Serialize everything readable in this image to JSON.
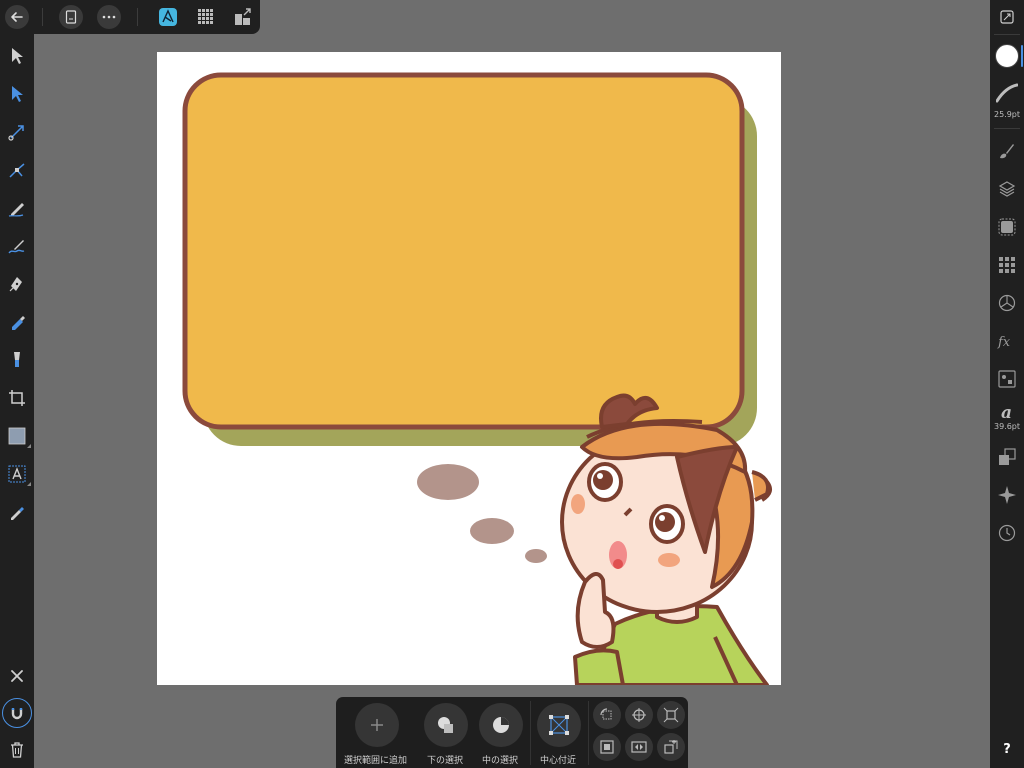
{
  "top_toolbar": {
    "items": [
      "back-icon",
      "document-icon",
      "more-icon",
      "designer-persona-icon",
      "pixel-persona-icon",
      "export-persona-icon"
    ]
  },
  "left_tools": [
    "move-tool-icon",
    "node-tool-icon",
    "point-transform-tool-icon",
    "corner-tool-icon",
    "pencil-tool-icon",
    "vector-brush-tool-icon",
    "pen-tool-icon",
    "fill-tool-icon",
    "transparency-tool-icon",
    "crop-tool-icon",
    "rectangle-shape-tool-icon",
    "artistic-text-tool-icon",
    "color-picker-tool-icon"
  ],
  "left_bottom": [
    "close-icon",
    "snapping-icon",
    "trash-icon"
  ],
  "right_panel": {
    "stroke_width": "25.9pt",
    "font_size": "39.6pt",
    "help": "?",
    "items": [
      "fullscreen-icon",
      "color-swatch-icon",
      "stroke-icon",
      "brushes-icon",
      "layers-icon",
      "effects-icon",
      "swatches-icon",
      "appearance-icon",
      "fx-icon",
      "styles-icon",
      "text-icon",
      "transform-icon",
      "navigator-icon",
      "history-icon"
    ]
  },
  "context_toolbar": {
    "add_to_selection": "選択範囲に追加",
    "select_below": "下の選択",
    "select_inside": "中の選択",
    "center_near": "中心付近"
  },
  "colors": {
    "ui_dark": "#202020",
    "workspace": "#6e6e6e",
    "accent_blue": "#4a90e2",
    "bubble_fill": "#f0b94b",
    "bubble_stroke": "#8b4a3c",
    "bubble_shadow": "#a3a55a",
    "thought_dots": "#b3948b",
    "shirt_green": "#b7d35b",
    "skin": "#fbe2d4",
    "hair": "#e89a52"
  }
}
